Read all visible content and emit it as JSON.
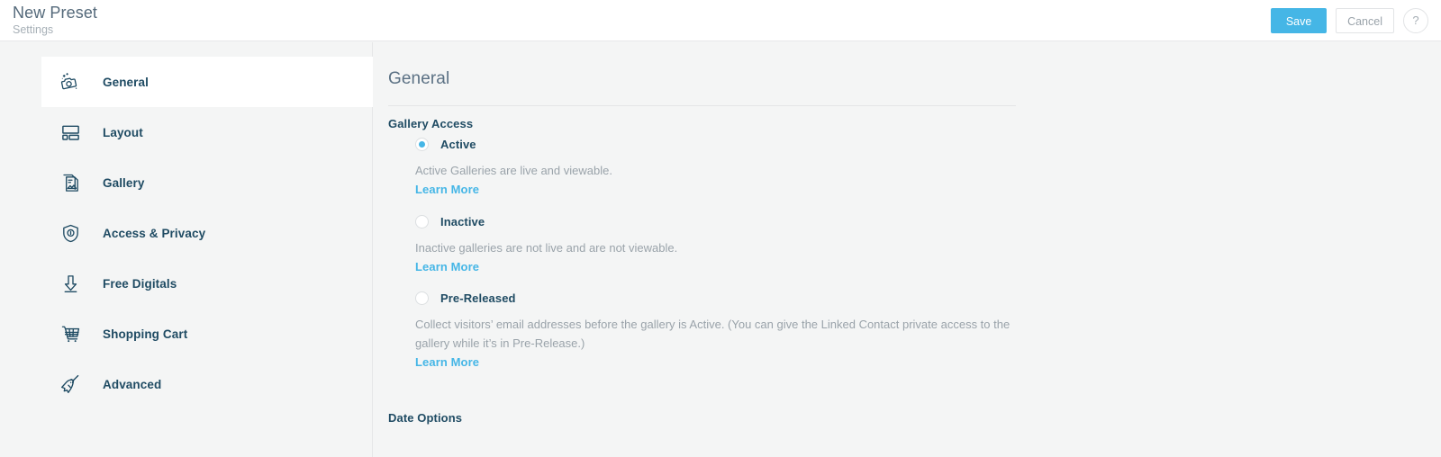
{
  "header": {
    "title": "New Preset",
    "subtitle": "Settings",
    "save_label": "Save",
    "cancel_label": "Cancel",
    "help_label": "?"
  },
  "colors": {
    "accent": "#45b6e6",
    "heading": "#1f4b63",
    "muted": "#9aa3aa",
    "page_bg": "#f4f5f5",
    "panel_bg": "#ffffff"
  },
  "sidebar": {
    "items": [
      {
        "label": "General",
        "icon": "camera-sparkle-icon",
        "active": true
      },
      {
        "label": "Layout",
        "icon": "layout-grid-icon",
        "active": false
      },
      {
        "label": "Gallery",
        "icon": "gallery-stack-icon",
        "active": false
      },
      {
        "label": "Access & Privacy",
        "icon": "shield-lock-icon",
        "active": false
      },
      {
        "label": "Free Digitals",
        "icon": "download-arrow-icon",
        "active": false
      },
      {
        "label": "Shopping Cart",
        "icon": "shopping-cart-icon",
        "active": false
      },
      {
        "label": "Advanced",
        "icon": "unicorn-icon",
        "active": false
      }
    ]
  },
  "main": {
    "section_title": "General",
    "gallery_access": {
      "heading": "Gallery Access",
      "options": [
        {
          "label": "Active",
          "selected": true,
          "description": "Active Galleries are live and viewable.",
          "learn_more": "Learn More"
        },
        {
          "label": "Inactive",
          "selected": false,
          "description": "Inactive galleries are not live and are not viewable.",
          "learn_more": "Learn More"
        },
        {
          "label": "Pre-Released",
          "selected": false,
          "description": "Collect visitors’ email addresses before the gallery is Active. (You can give the Linked Contact private access to the gallery while it’s in Pre-Release.)",
          "learn_more": "Learn More"
        }
      ]
    },
    "date_options": {
      "heading": "Date Options"
    }
  }
}
